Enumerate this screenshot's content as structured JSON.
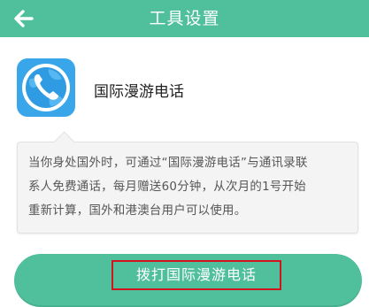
{
  "header": {
    "title": "工具设置",
    "back_icon": "arrow-left-icon",
    "color": "#4fbf9c"
  },
  "app": {
    "icon": "phone-globe-icon",
    "name": "国际漫游电话",
    "icon_color": "#3aa6ea"
  },
  "description": {
    "lines": [
      "当你身处国外时，可通过“国际漫游电话”与通讯录联",
      "系人免费通话，每月赠送60分钟，从次月的1号开始",
      "重新计算，国外和港澳台用户可以使用。"
    ]
  },
  "action": {
    "label": "拨打国际漫游电话",
    "highlight_color": "#d0151f"
  }
}
